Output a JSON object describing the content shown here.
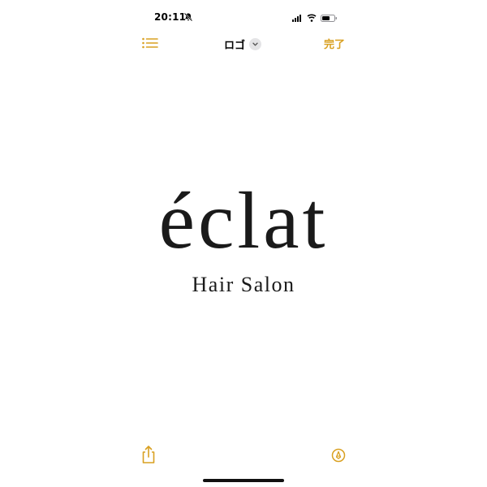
{
  "status_bar": {
    "time": "20:11",
    "icons": [
      "bell-slash-icon",
      "signal-icon",
      "wifi-icon",
      "battery-icon"
    ]
  },
  "nav_bar": {
    "title": "ロゴ",
    "done_label": "完了",
    "icons": [
      "list-icon",
      "chevron-down-icon"
    ]
  },
  "logo": {
    "main": "éclat",
    "sub": "Hair Salon"
  },
  "toolbar": {
    "icons": [
      "share-icon",
      "markup-icon"
    ]
  },
  "colors": {
    "accent": "#d9a021",
    "text": "#1a1a1a",
    "background": "#ffffff"
  }
}
